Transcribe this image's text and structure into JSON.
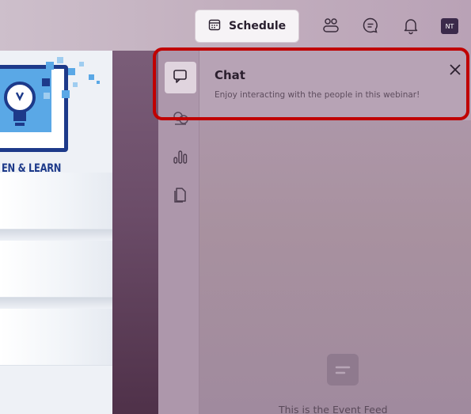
{
  "header": {
    "schedule_label": "Schedule",
    "avatar_initials": "NT",
    "icons": [
      "calendar-icon",
      "people-icon",
      "chat-bubble-icon",
      "bell-icon"
    ]
  },
  "slide": {
    "logo_caption": "EN & LEARN"
  },
  "rail": {
    "items": [
      {
        "name": "chat",
        "icon": "chat-icon",
        "active": true
      },
      {
        "name": "people",
        "icon": "people-chat-icon",
        "active": false
      },
      {
        "name": "polls",
        "icon": "polls-icon",
        "active": false
      },
      {
        "name": "files",
        "icon": "files-icon",
        "active": false
      }
    ]
  },
  "chat": {
    "title": "Chat",
    "subtitle": "Enjoy interacting with the people in this webinar!",
    "close_icon": "close-icon"
  },
  "feed": {
    "empty_text": "This is the Event Feed"
  },
  "colors": {
    "highlight": "#c00000",
    "logo_blue": "#1d3a8a",
    "panel": "#b09aae",
    "strip": "#6b4c68"
  }
}
